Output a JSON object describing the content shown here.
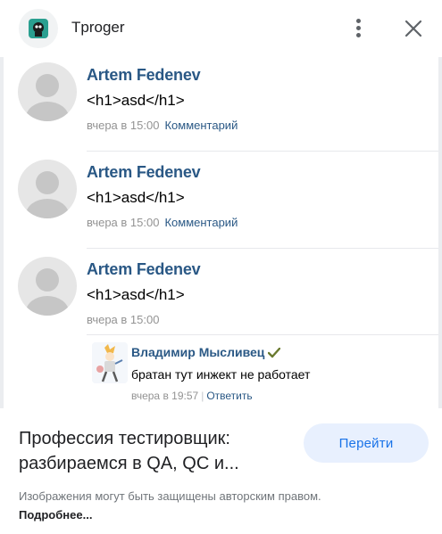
{
  "header": {
    "app_icon": "tproger-logo",
    "title": "Tproger",
    "menu_icon": "more-vert-icon",
    "close_icon": "close-icon"
  },
  "comments": [
    {
      "author": "Artem Fedenev",
      "text": "<h1>asd</h1>",
      "time": "вчера в 15:00",
      "reply_label": "Комментарий"
    },
    {
      "author": "Artem Fedenev",
      "text": "<h1>asd</h1>",
      "time": "вчера в 15:00",
      "reply_label": "Комментарий"
    },
    {
      "author": "Artem Fedenev",
      "text": "<h1>asd</h1>",
      "time": "вчера в 15:00"
    }
  ],
  "reply": {
    "author": "Владимир Мысливец",
    "verified": true,
    "text": "братан тут инжект не работает",
    "time": "вчера в 19:57",
    "action": "Ответить"
  },
  "page_info": {
    "title": "Профессия тестировщик: разбираемся в QA, QC и...",
    "button_label": "Перейти",
    "copyright": "Изображения могут быть защищены авторским правом.",
    "more_label": "Подробнее..."
  },
  "colors": {
    "link": "#2a5885",
    "meta": "#939393",
    "button_bg": "#e8f0fe",
    "button_text": "#1a73e8",
    "logo_bg": "#2a9f90"
  }
}
